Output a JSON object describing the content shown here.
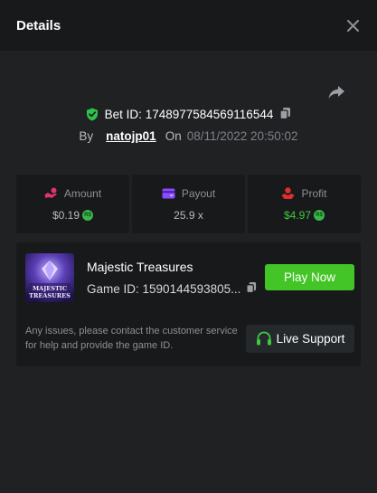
{
  "header": {
    "title": "Details"
  },
  "bet": {
    "id_label": "Bet ID:",
    "id": "1748977584569116544",
    "by_label": "By",
    "username": "natojp01",
    "on_label": "On",
    "datetime": "08/11/2022 20:50:02"
  },
  "stats": [
    {
      "label": "Amount",
      "value": "$0.19",
      "icon": "hand-coin-icon",
      "color": "#e0356b"
    },
    {
      "label": "Payout",
      "value": "25.9 x",
      "icon": "wallet-icon",
      "color": "#8a4bff"
    },
    {
      "label": "Profit",
      "value": "$4.97",
      "icon": "hand-money-icon",
      "color": "#e02f2f"
    }
  ],
  "coin": {
    "label": "R$"
  },
  "game": {
    "thumb_line1": "MAJESTIC",
    "thumb_line2": "TREASURES",
    "title": "Majestic Treasures",
    "id_label": "Game ID:",
    "id": "1590144593805...",
    "play_label": "Play Now"
  },
  "support": {
    "text": "Any issues, please contact the customer service for help and provide the game ID.",
    "button_label": "Live Support"
  },
  "colors": {
    "accent_green": "#43c427",
    "shield_green": "#2fc14a",
    "profit_green": "#3ec93e"
  }
}
